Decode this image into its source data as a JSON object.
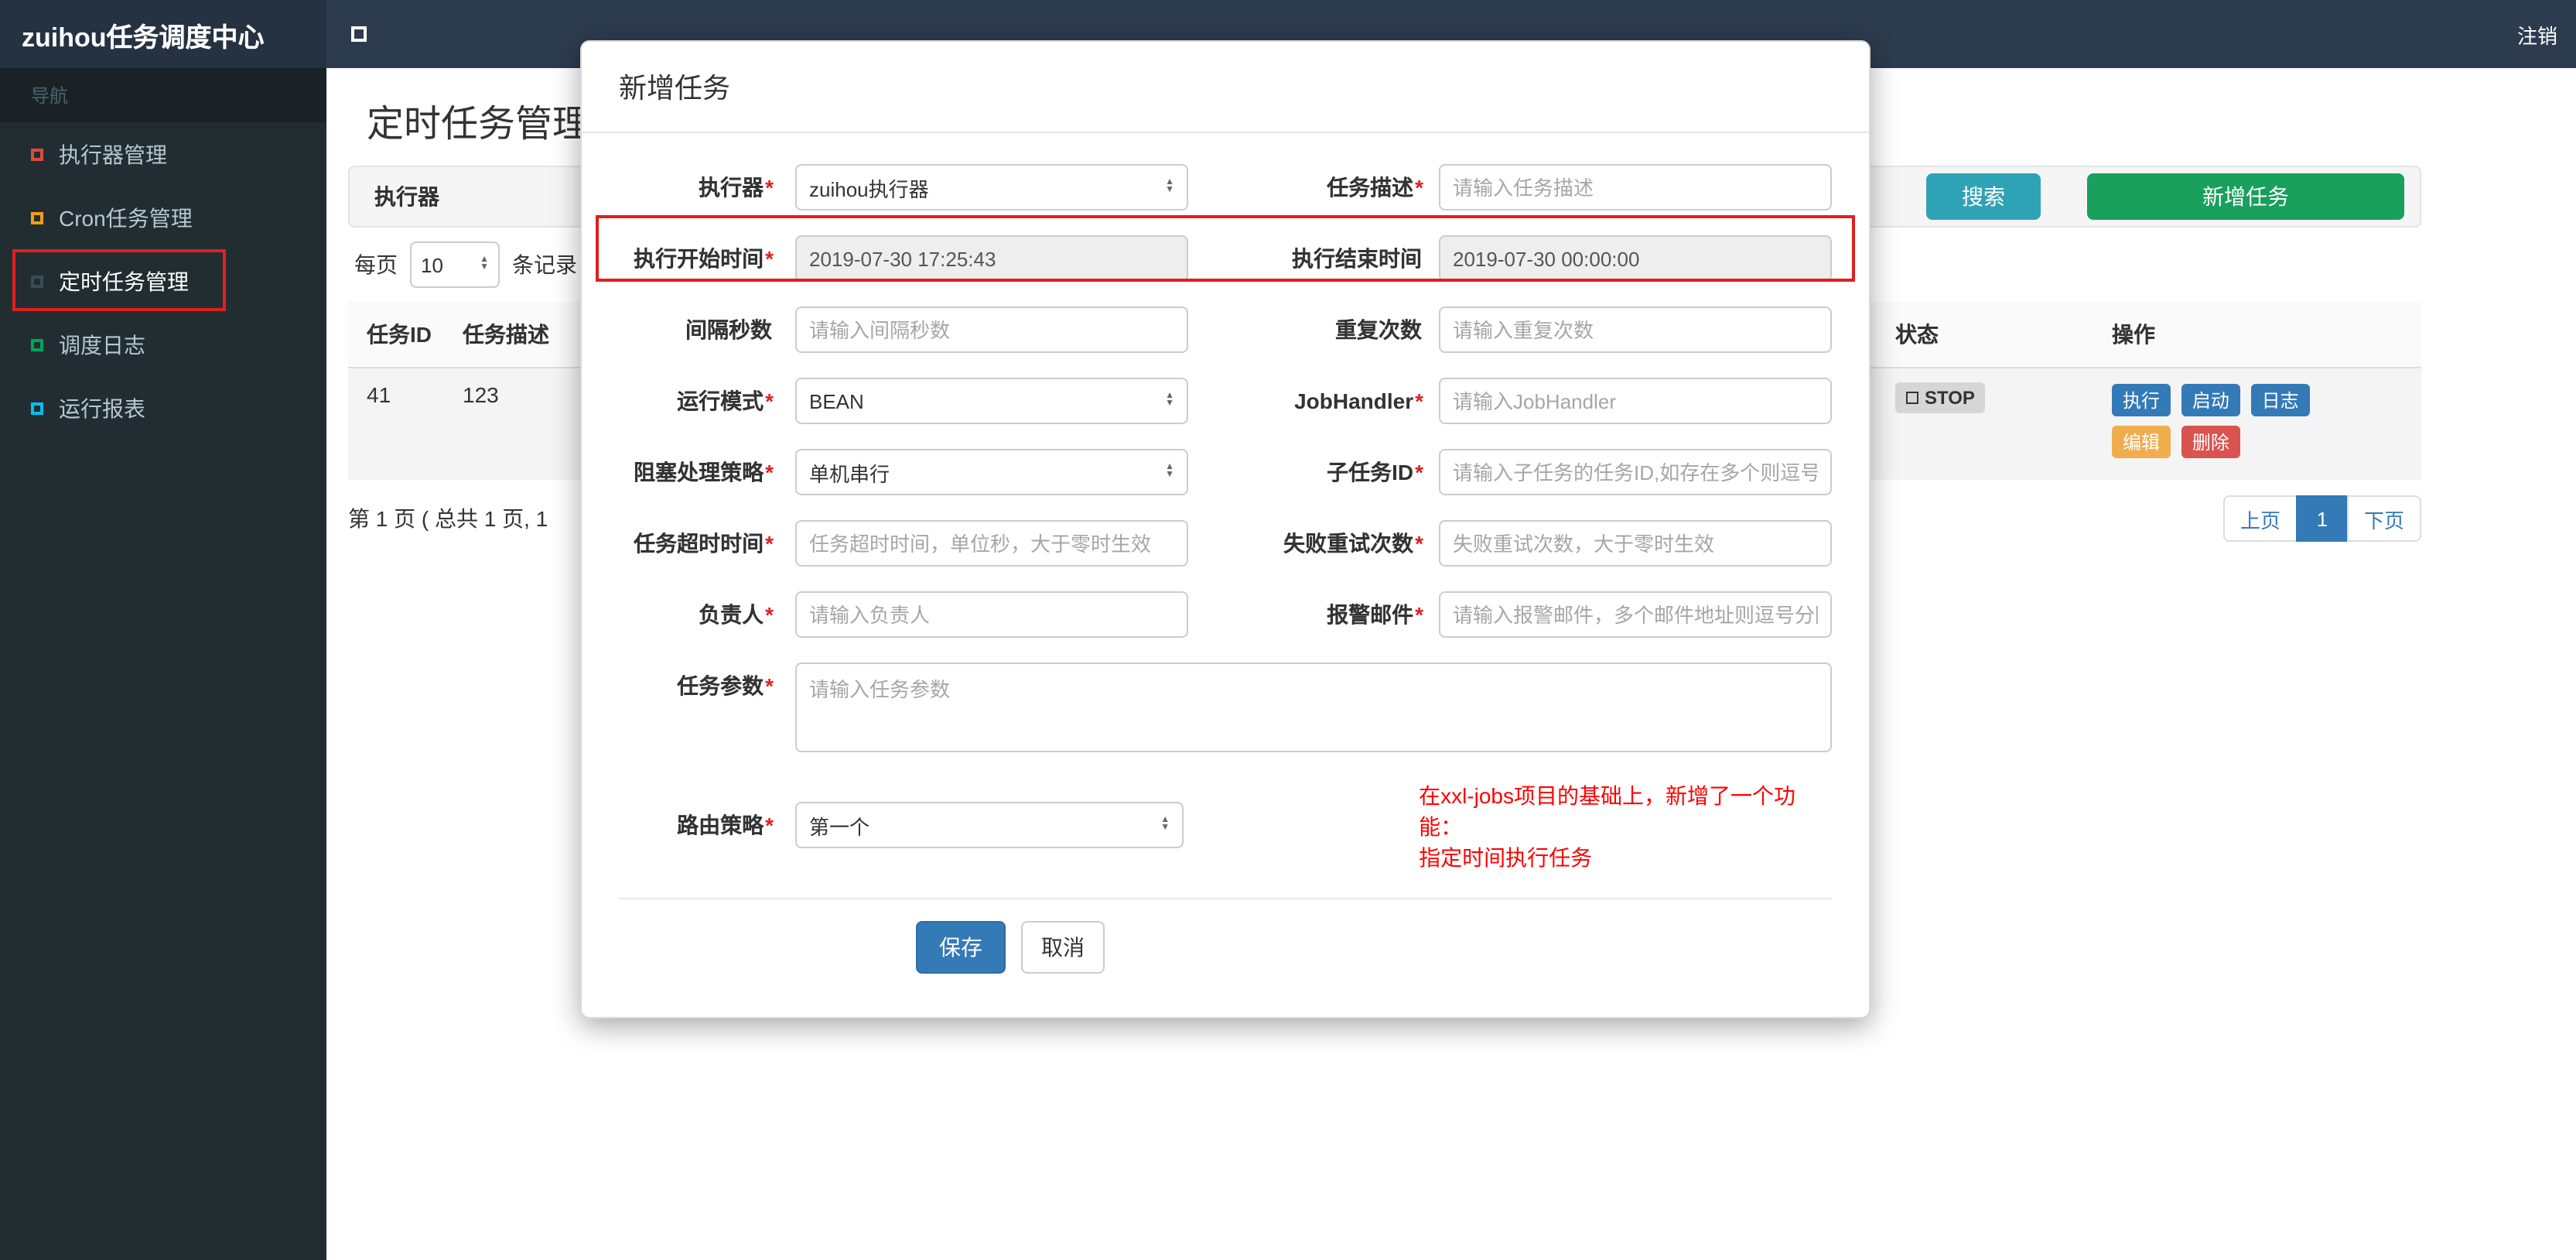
{
  "colors": {
    "navbar": "#2d3b4e",
    "brand_bg": "#253241",
    "sidebar": "#222d32",
    "primary_blue": "#337ab7",
    "search_teal": "#2fa3b6",
    "add_green": "#18a05c",
    "warning_orange": "#f0ad4e",
    "danger_red": "#d9534f",
    "annotation_red": "#e01f1f"
  },
  "topbar": {
    "brand": "zuihou任务调度中心",
    "logout": "注销"
  },
  "sidebar": {
    "nav_label": "导航",
    "items": [
      {
        "label": "执行器管理",
        "color": "#dd4b39"
      },
      {
        "label": "Cron任务管理",
        "color": "#f39c12"
      },
      {
        "label": "定时任务管理",
        "color": "#3e4a52"
      },
      {
        "label": "调度日志",
        "color": "#00a65a"
      },
      {
        "label": "运行报表",
        "color": "#00c0ef"
      }
    ]
  },
  "page": {
    "title": "定时任务管理",
    "filter": {
      "executor_label": "执行器",
      "search_button": "搜索",
      "add_button": "新增任务"
    },
    "per_page": {
      "prefix": "每页",
      "value": "10",
      "suffix": "条记录"
    },
    "table": {
      "headers": [
        "任务ID",
        "任务描述",
        "状态",
        "操作"
      ],
      "row": {
        "id": "41",
        "desc": "123",
        "status": "STOP",
        "actions": [
          {
            "label": "执行",
            "color": "#337ab7"
          },
          {
            "label": "启动",
            "color": "#337ab7"
          },
          {
            "label": "日志",
            "color": "#337ab7"
          },
          {
            "label": "编辑",
            "color": "#f0ad4e"
          },
          {
            "label": "删除",
            "color": "#d9534f"
          }
        ]
      }
    },
    "pagination": {
      "summary": "第 1 页 ( 总共 1 页, 1",
      "prev": "上页",
      "current": "1",
      "next": "下页"
    }
  },
  "modal": {
    "title": "新增任务",
    "fields": {
      "executor": {
        "label": "执行器",
        "req": "*",
        "value": "zuihou执行器"
      },
      "job_desc": {
        "label": "任务描述",
        "req": "*",
        "placeholder": "请输入任务描述"
      },
      "start_time": {
        "label": "执行开始时间",
        "req": "*",
        "value": "2019-07-30 17:25:43"
      },
      "end_time": {
        "label": "执行结束时间",
        "req": "",
        "value": "2019-07-30 00:00:00"
      },
      "interval": {
        "label": "间隔秒数",
        "req": "",
        "placeholder": "请输入间隔秒数"
      },
      "repeat_count": {
        "label": "重复次数",
        "req": "",
        "placeholder": "请输入重复次数"
      },
      "glue_type": {
        "label": "运行模式",
        "req": "*",
        "value": "BEAN"
      },
      "job_handler": {
        "label": "JobHandler",
        "req": "*",
        "placeholder": "请输入JobHandler"
      },
      "block_strategy": {
        "label": "阻塞处理策略",
        "req": "*",
        "value": "单机串行"
      },
      "child_jobid": {
        "label": "子任务ID",
        "req": "*",
        "placeholder": "请输入子任务的任务ID,如存在多个则逗号分隔"
      },
      "timeout": {
        "label": "任务超时时间",
        "req": "*",
        "placeholder": "任务超时时间，单位秒，大于零时生效"
      },
      "retry_count": {
        "label": "失败重试次数",
        "req": "*",
        "placeholder": "失败重试次数，大于零时生效"
      },
      "author": {
        "label": "负责人",
        "req": "*",
        "placeholder": "请输入负责人"
      },
      "alarm_email": {
        "label": "报警邮件",
        "req": "*",
        "placeholder": "请输入报警邮件，多个邮件地址则逗号分隔"
      },
      "job_param": {
        "label": "任务参数",
        "req": "*",
        "placeholder": "请输入任务参数"
      },
      "route_strategy": {
        "label": "路由策略",
        "req": "*",
        "value": "第一个"
      }
    },
    "note_line1": "在xxl-jobs项目的基础上，新增了一个功能：",
    "note_line2": "指定时间执行任务",
    "save_button": "保存",
    "cancel_button": "取消"
  }
}
